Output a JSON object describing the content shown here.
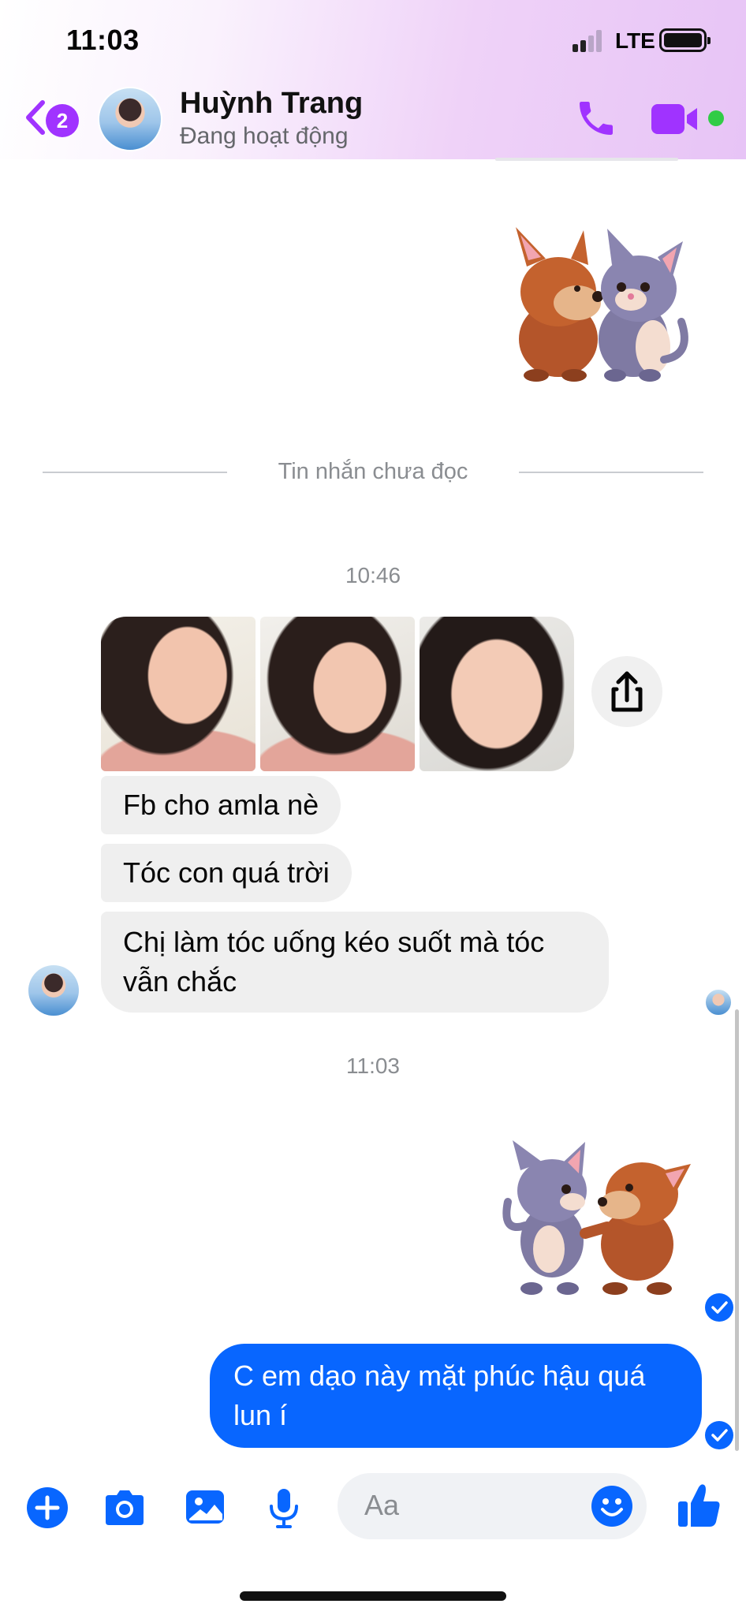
{
  "status_bar": {
    "time": "11:03",
    "network": "LTE"
  },
  "header": {
    "back_badge": "2",
    "contact_name": "Huỳnh Trang",
    "contact_status": "Đang hoạt động",
    "accent_color": "#a033ff",
    "online_color": "#31cc46"
  },
  "conversation": {
    "unread_divider": "Tin nhắn chưa đọc",
    "timestamps": [
      "10:46",
      "11:03"
    ],
    "incoming_messages": [
      "Fb cho amla nè",
      "Tóc con quá trời",
      "Chị làm tóc uống kéo suốt mà tóc vẫn chắc"
    ],
    "outgoing_messages": [
      "C em dạo này mặt phúc hậu quá lun í"
    ],
    "photo_count": 3,
    "stickers": [
      "dog-cat-sticker",
      "cat-dog-sticker"
    ],
    "outgoing_bubble_color": "#0866ff"
  },
  "composer": {
    "placeholder": "Aa",
    "icons": [
      "plus-icon",
      "camera-icon",
      "gallery-icon",
      "microphone-icon",
      "emoji-icon",
      "thumbs-up-icon"
    ]
  }
}
